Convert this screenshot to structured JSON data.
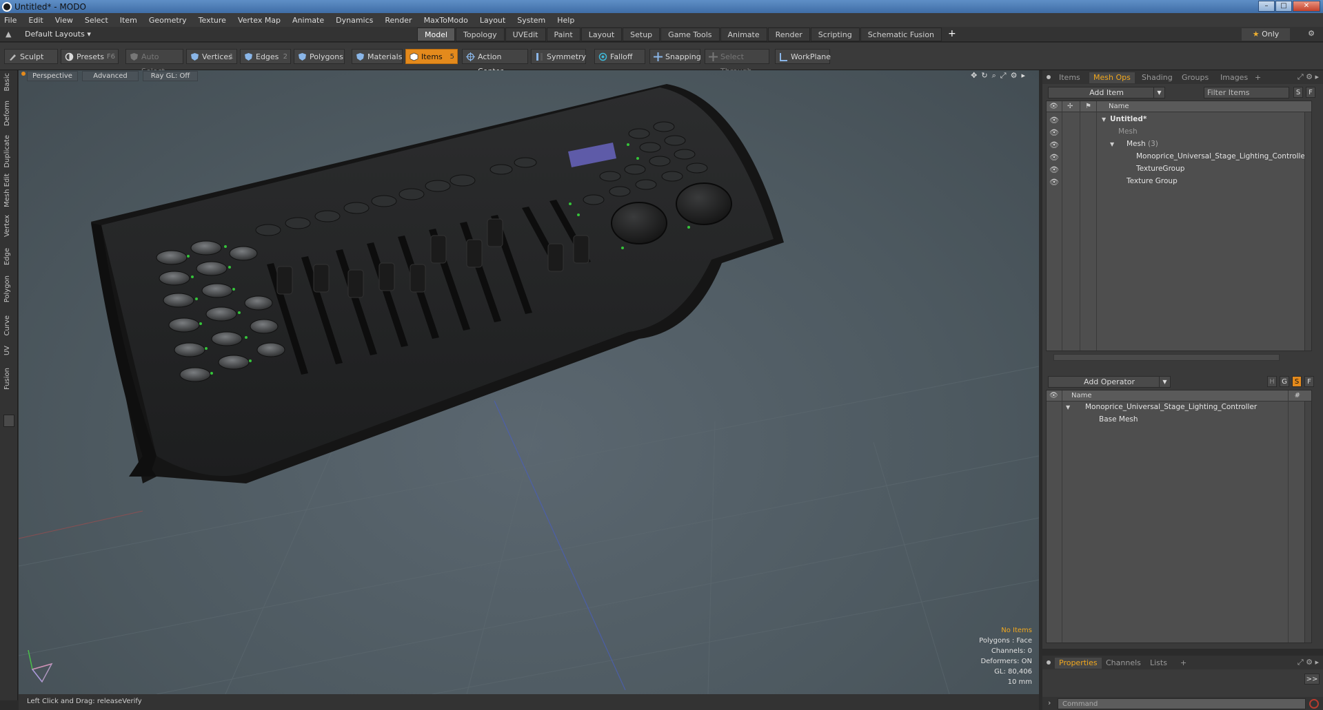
{
  "window": {
    "title": "Untitled* - MODO"
  },
  "menu": [
    "File",
    "Edit",
    "View",
    "Select",
    "Item",
    "Geometry",
    "Texture",
    "Vertex Map",
    "Animate",
    "Dynamics",
    "Render",
    "MaxToModo",
    "Layout",
    "System",
    "Help"
  ],
  "layout": {
    "selector": "Default Layouts",
    "tabs": [
      "Model",
      "Topology",
      "UVEdit",
      "Paint",
      "Layout",
      "Setup",
      "Game Tools",
      "Animate",
      "Render",
      "Scripting",
      "Schematic Fusion"
    ],
    "active_tab": "Model",
    "only_label": "Only"
  },
  "toolbar": {
    "sculpt": "Sculpt",
    "presets": "Presets",
    "presets_key": "F6",
    "auto_select": "Auto Select",
    "vertices": "Vertices",
    "vertices_key": "1",
    "edges": "Edges",
    "edges_key": "2",
    "polygons": "Polygons",
    "materials": "Materials",
    "items": "Items",
    "items_key": "5",
    "action_center": "Action Center",
    "symmetry": "Symmetry",
    "falloff": "Falloff",
    "snapping": "Snapping",
    "select_through": "Select Through",
    "workplane": "WorkPlane"
  },
  "left_tabs": [
    "Basic",
    "Deform",
    "Duplicate",
    "Mesh Edit",
    "Vertex",
    "Edge",
    "Polygon",
    "Curve",
    "UV",
    "Fusion"
  ],
  "viewport": {
    "view": "Perspective",
    "mode": "Advanced",
    "raygl": "Ray GL: Off",
    "info": {
      "no_items": "No Items",
      "polygons": "Polygons : Face",
      "channels": "Channels: 0",
      "deformers": "Deformers: ON",
      "gl": "GL: 80,406",
      "scale": "10 mm"
    }
  },
  "status": {
    "text": "Left Click and Drag:  releaseVerify"
  },
  "items_panel": {
    "tabs": [
      "Items",
      "Mesh Ops",
      "Shading",
      "Groups",
      "Images"
    ],
    "active_tab": "Mesh Ops",
    "add_item": "Add Item",
    "filter_placeholder": "Filter Items",
    "s_btn": "S",
    "f_btn": "F",
    "col_name": "Name",
    "rows": [
      {
        "label": "Untitled*",
        "count": ""
      },
      {
        "label": "Mesh",
        "count": ""
      },
      {
        "label": "Mesh",
        "count": "(3)"
      },
      {
        "label": "Monoprice_Universal_Stage_Lighting_Controller",
        "count": ""
      },
      {
        "label": "TextureGroup",
        "count": ""
      },
      {
        "label": "Texture Group",
        "count": ""
      }
    ]
  },
  "meshops_panel": {
    "add_operator": "Add Operator",
    "btn_h": "H",
    "btn_g": "G",
    "btn_s": "S",
    "btn_f": "F",
    "col_name": "Name",
    "col_hash": "#",
    "rows": [
      {
        "label": "Monoprice_Universal_Stage_Lighting_Controller"
      },
      {
        "label": "Base Mesh"
      }
    ]
  },
  "properties_panel": {
    "tabs": [
      "Properties",
      "Channels",
      "Lists"
    ],
    "active_tab": "Properties",
    "expand": ">>"
  },
  "command": {
    "placeholder": "Command"
  },
  "colors": {
    "accent": "#e48a1c",
    "accent_text": "#f2a81e"
  }
}
